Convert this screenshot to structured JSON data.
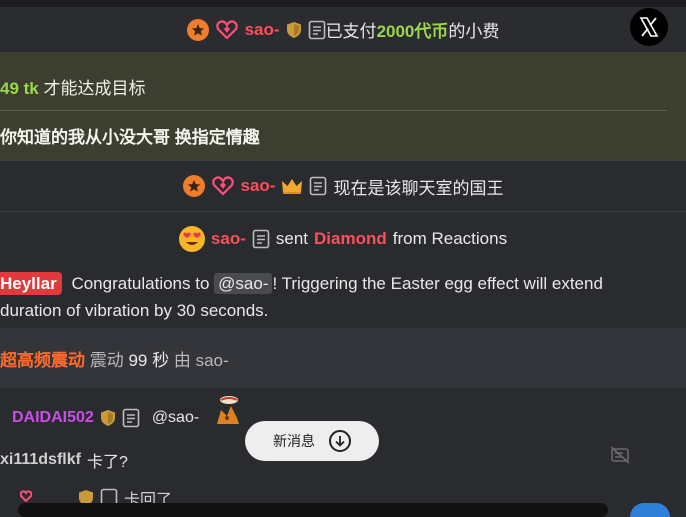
{
  "row1": {
    "username": "sao-",
    "text_before": "已支付",
    "amount": "2000代币",
    "text_after": "的小费"
  },
  "goal": {
    "progress_text_amount": "49 tk",
    "progress_text_rest": " 才能达成目标",
    "subtitle": "你知道的我从小没大哥 换指定情趣"
  },
  "row3": {
    "username": "sao-",
    "text": "现在是该聊天室的国王"
  },
  "row4": {
    "username": "sao-",
    "sent": "sent",
    "item": "Diamond",
    "suffix": "from Reactions"
  },
  "bot": {
    "tag": "Heyllar",
    "before": "Congratulations to",
    "mention": "@sao-",
    "after": "! Triggering the Easter egg effect will extend",
    "line2": "duration of vibration by 30 seconds."
  },
  "vibration": {
    "mode": "超高频震动",
    "label": "震动",
    "duration": "99 秒",
    "by": "由",
    "user": "sao-"
  },
  "chat1": {
    "username": "DAIDAI502",
    "mention": "@sao-"
  },
  "chat2": {
    "username": "xi111dsflkf",
    "message": "卡了?"
  },
  "chat3": {
    "message": "卡回了"
  },
  "new_messages_button": {
    "label": "新消息"
  },
  "colors": {
    "accent_red": "#ff4d5e",
    "accent_green": "#9cd64a",
    "goal_bg": "#3c3e2f",
    "purple": "#c94de6"
  },
  "icons": [
    "close-x-icon",
    "orange-badge-icon",
    "heart-gem-icon",
    "shield-icon",
    "document-icon",
    "crown-icon",
    "heart-eyes-emoji",
    "arrow-down-circle-icon",
    "mute-icon"
  ]
}
